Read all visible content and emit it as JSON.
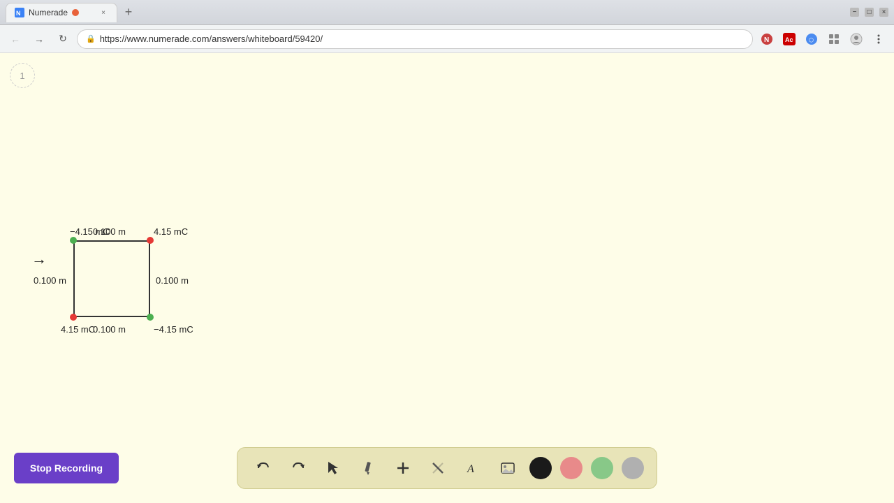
{
  "browser": {
    "tab": {
      "favicon": "N",
      "title": "Numerade",
      "recording_indicator": true,
      "close_label": "×"
    },
    "new_tab_label": "+",
    "window_controls": {
      "minimize": "−",
      "maximize": "□",
      "close": "×"
    },
    "nav": {
      "back": "←",
      "forward": "→",
      "reload": "↻"
    },
    "address": "https://www.numerade.com/answers/whiteboard/59420/",
    "toolbar_icons": [
      "⊙",
      "☆",
      "⋮"
    ]
  },
  "page": {
    "number": "1",
    "background_color": "#fefde8"
  },
  "diagram": {
    "arrow": "→",
    "labels": {
      "top_left_charge": "−4.15 mC",
      "top_right_charge": "4.15 mC",
      "bottom_left_charge": "4.15 mC",
      "bottom_right_charge": "−4.15 mC",
      "top_distance": "0.100 m",
      "left_distance": "0.100 m",
      "right_distance": "0.100 m",
      "bottom_distance": "0.100 m"
    }
  },
  "toolbar": {
    "undo": "↺",
    "redo": "↻",
    "select": "▲",
    "pencil": "✏",
    "add": "+",
    "eraser": "/",
    "text": "A",
    "image": "🖼",
    "colors": {
      "black": "#1a1a1a",
      "pink": "#e88a8a",
      "green": "#88c888",
      "gray": "#b0b0b0"
    }
  },
  "stop_recording": {
    "label": "Stop Recording"
  }
}
